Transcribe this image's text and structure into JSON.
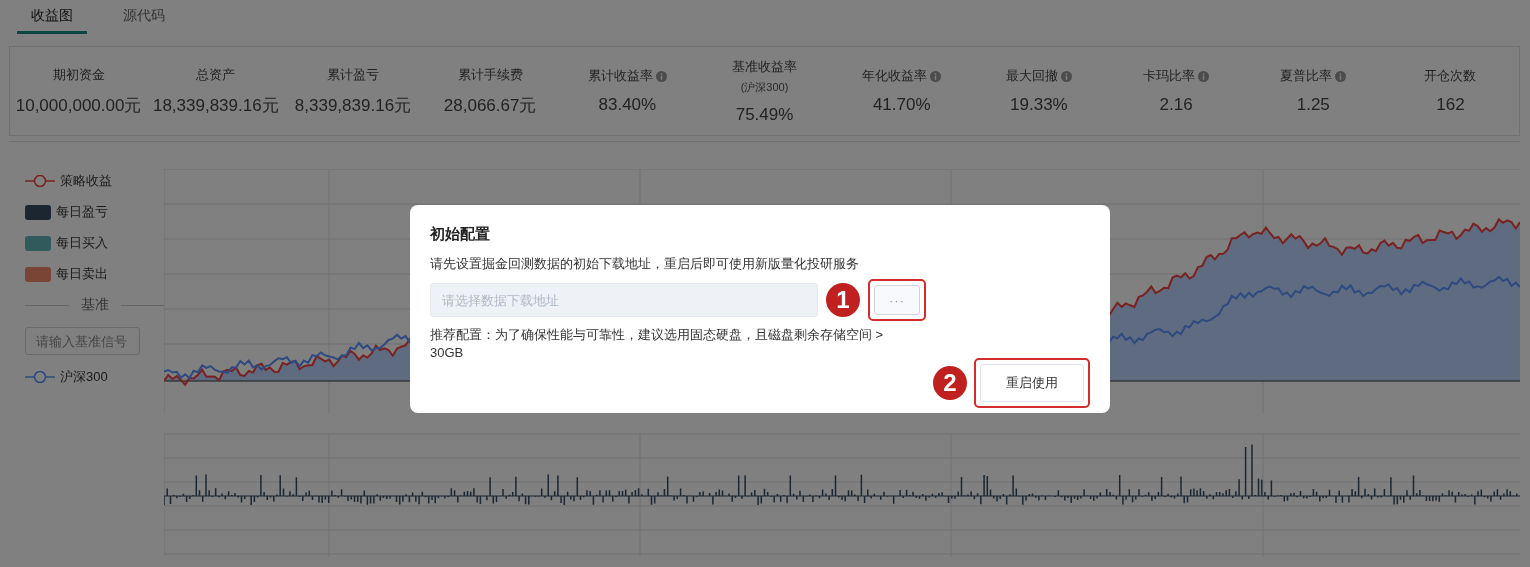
{
  "tabs": [
    {
      "label": "收益图",
      "selected": true
    },
    {
      "label": "源代码",
      "selected": false
    }
  ],
  "stats": [
    {
      "label": "期初资金",
      "value": "10,000,000.00元",
      "info": false
    },
    {
      "label": "总资产",
      "value": "18,339,839.16元",
      "info": false
    },
    {
      "label": "累计盈亏",
      "value": "8,339,839.16元",
      "info": false
    },
    {
      "label": "累计手续费",
      "value": "28,066.67元",
      "info": false
    },
    {
      "label": "累计收益率",
      "value": "83.40%",
      "info": true
    },
    {
      "label": "基准收益率",
      "sublabel": "(沪深300)",
      "value": "75.49%",
      "info": false
    },
    {
      "label": "年化收益率",
      "value": "41.70%",
      "info": true
    },
    {
      "label": "最大回撤",
      "value": "19.33%",
      "info": true
    },
    {
      "label": "卡玛比率",
      "value": "2.16",
      "info": true
    },
    {
      "label": "夏普比率",
      "value": "1.25",
      "info": true
    },
    {
      "label": "开仓次数",
      "value": "162",
      "info": false
    }
  ],
  "legend": [
    {
      "kind": "line",
      "label": "策略收益",
      "color": "#7a2222"
    },
    {
      "kind": "swatch",
      "label": "每日盈亏",
      "color": "#1b2631"
    },
    {
      "kind": "swatch",
      "label": "每日买入",
      "color": "#305a5c"
    },
    {
      "kind": "swatch",
      "label": "每日卖出",
      "color": "#7a4535"
    }
  ],
  "benchmark": {
    "title": "基准",
    "placeholder": "请输入基准信号",
    "legend": {
      "kind": "line",
      "label": "沪深300",
      "color": "#2f4a80"
    }
  },
  "dialog": {
    "title": "初始配置",
    "description": "请先设置掘金回测数据的初始下载地址，重启后即可使用新版量化投研服务",
    "path_field": {
      "placeholder": "请选择数据下载地址"
    },
    "browse_button": "···",
    "note": "推荐配置：为了确保性能与可靠性，建议选用固态硬盘，且磁盘剩余存储空间 > 30GB",
    "confirm_button": "重启使用",
    "callouts": [
      "1",
      "2"
    ]
  }
}
